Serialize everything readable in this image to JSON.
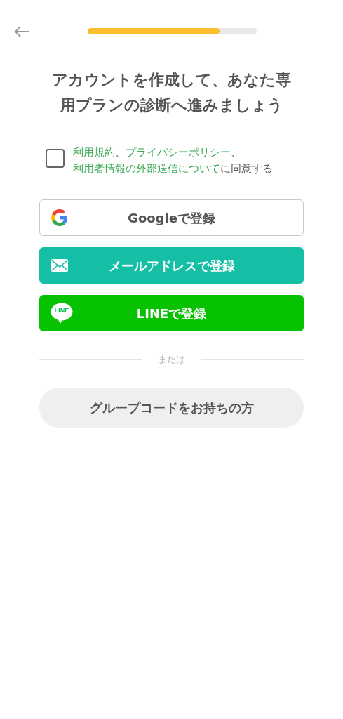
{
  "header": {
    "progress": {
      "level": 0.78
    }
  },
  "title": "アカウントを作成して、あなた専用プランの診断へ進みましょう",
  "agreement": {
    "checked": false,
    "segments": [
      {
        "kind": "link",
        "text": "利用規約"
      },
      {
        "kind": "text",
        "text": "、"
      },
      {
        "kind": "link",
        "text": "プライバシーポリシー"
      },
      {
        "kind": "text",
        "text": "、"
      },
      {
        "kind": "link",
        "text": "利用者情報の外部送信について"
      },
      {
        "kind": "text",
        "text": "に同意する"
      }
    ]
  },
  "signup_buttons": [
    {
      "kind": "google",
      "label": "Googleで登録"
    },
    {
      "kind": "email",
      "label": "メールアドレスで登録"
    },
    {
      "kind": "line",
      "label": "LINEで登録",
      "logo_text": "LINE"
    }
  ],
  "divider": "または",
  "group_button": "グループコードをお持ちの方"
}
